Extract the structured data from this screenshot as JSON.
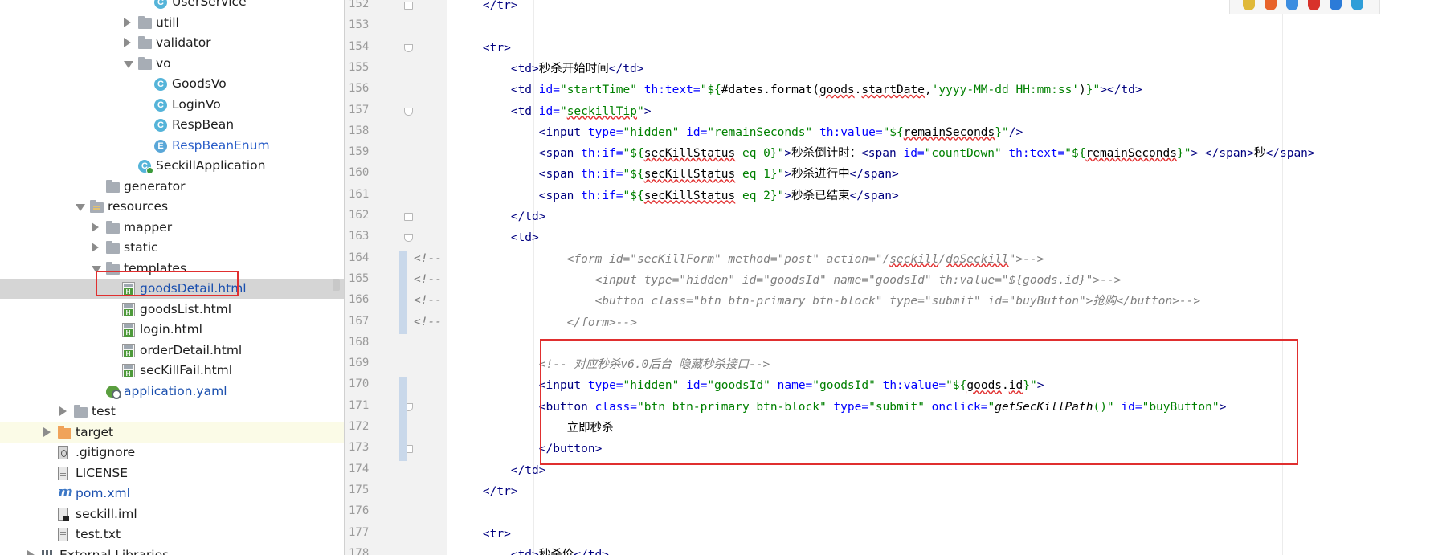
{
  "tree": {
    "items": [
      {
        "label": "UserService",
        "icon": "class-icon",
        "depth": 7
      },
      {
        "label": "utill",
        "icon": "folder-icon",
        "depth": 6,
        "state": "collapsed"
      },
      {
        "label": "validator",
        "icon": "folder-icon",
        "depth": 6,
        "state": "collapsed"
      },
      {
        "label": "vo",
        "icon": "folder-icon",
        "depth": 6,
        "state": "expanded"
      },
      {
        "label": "GoodsVo",
        "icon": "class-icon",
        "depth": 7
      },
      {
        "label": "LoginVo",
        "icon": "class-icon",
        "depth": 7
      },
      {
        "label": "RespBean",
        "icon": "class-icon",
        "depth": 7
      },
      {
        "label": "RespBeanEnum",
        "icon": "enum-icon",
        "depth": 7
      },
      {
        "label": "SeckillApplication",
        "icon": "spring-boot-class-icon",
        "depth": 6
      },
      {
        "label": "generator",
        "icon": "folder-icon",
        "depth": 4
      },
      {
        "label": "resources",
        "icon": "resources-folder-icon",
        "depth": 3,
        "state": "expanded"
      },
      {
        "label": "mapper",
        "icon": "folder-icon",
        "depth": 4,
        "state": "collapsed"
      },
      {
        "label": "static",
        "icon": "folder-icon",
        "depth": 4,
        "state": "collapsed"
      },
      {
        "label": "templates",
        "icon": "folder-icon",
        "depth": 4,
        "state": "expanded"
      },
      {
        "label": "goodsDetail.html",
        "icon": "html-file-icon",
        "depth": 5,
        "selected": true
      },
      {
        "label": "goodsList.html",
        "icon": "html-file-icon",
        "depth": 5
      },
      {
        "label": "login.html",
        "icon": "html-file-icon",
        "depth": 5
      },
      {
        "label": "orderDetail.html",
        "icon": "html-file-icon",
        "depth": 5
      },
      {
        "label": "secKillFail.html",
        "icon": "html-file-icon",
        "depth": 5
      },
      {
        "label": "application.yaml",
        "icon": "yaml-file-icon",
        "depth": 4
      },
      {
        "label": "test",
        "icon": "folder-icon",
        "depth": 2,
        "state": "collapsed"
      },
      {
        "label": "target",
        "icon": "excluded-folder-icon",
        "depth": 1,
        "state": "collapsed"
      },
      {
        "label": ".gitignore",
        "icon": "gitignore-file-icon",
        "depth": 1
      },
      {
        "label": "LICENSE",
        "icon": "text-file-icon",
        "depth": 1
      },
      {
        "label": "pom.xml",
        "icon": "maven-file-icon",
        "depth": 1
      },
      {
        "label": "seckill.iml",
        "icon": "iml-file-icon",
        "depth": 1
      },
      {
        "label": "test.txt",
        "icon": "text-file-icon",
        "depth": 1
      },
      {
        "label": "External Libraries",
        "icon": "libraries-icon",
        "depth": 0,
        "state": "collapsed"
      }
    ]
  },
  "gutter": {
    "line_numbers": [
      "152",
      "153",
      "154",
      "155",
      "156",
      "157",
      "158",
      "159",
      "160",
      "161",
      "162",
      "163",
      "164",
      "165",
      "166",
      "167",
      "168",
      "169",
      "170",
      "171",
      "172",
      "173",
      "174",
      "175",
      "176",
      "177",
      "178"
    ]
  },
  "code": {
    "lines": [
      [
        {
          "t": "    </tr>",
          "c": "tag"
        }
      ],
      [],
      [
        {
          "t": "    <tr>",
          "c": "tag"
        }
      ],
      [
        {
          "t": "        <td>",
          "c": "tag"
        },
        {
          "t": "秒杀开始时间",
          "c": "tx"
        },
        {
          "t": "</td>",
          "c": "tag"
        }
      ],
      [
        {
          "t": "        <td ",
          "c": "tag"
        },
        {
          "t": "id=",
          "c": "attr"
        },
        {
          "t": "\"startTime\" ",
          "c": "str"
        },
        {
          "t": "th:text=",
          "c": "attr"
        },
        {
          "t": "\"${",
          "c": "str"
        },
        {
          "t": "#dates.format(",
          "c": "ev"
        },
        {
          "t": "goods",
          "c": "sq"
        },
        {
          "t": ".",
          "c": "ev"
        },
        {
          "t": "startDate",
          "c": "sq"
        },
        {
          "t": ",",
          "c": "ev"
        },
        {
          "t": "'yyyy-MM-dd HH:mm:ss'",
          "c": "str"
        },
        {
          "t": ")",
          "c": "ev"
        },
        {
          "t": "}\"",
          "c": "str"
        },
        {
          "t": "></td>",
          "c": "tag"
        }
      ],
      [
        {
          "t": "        <td ",
          "c": "tag"
        },
        {
          "t": "id=",
          "c": "attr"
        },
        {
          "t": "\"",
          "c": "str"
        },
        {
          "t": "seckillTip",
          "c": "sqstr"
        },
        {
          "t": "\"",
          "c": "str"
        },
        {
          "t": ">",
          "c": "tag"
        }
      ],
      [
        {
          "t": "            <input ",
          "c": "tag"
        },
        {
          "t": "type=",
          "c": "attr"
        },
        {
          "t": "\"hidden\" ",
          "c": "str"
        },
        {
          "t": "id=",
          "c": "attr"
        },
        {
          "t": "\"remainSeconds\" ",
          "c": "str"
        },
        {
          "t": "th:value=",
          "c": "attr"
        },
        {
          "t": "\"${",
          "c": "str"
        },
        {
          "t": "remainSeconds",
          "c": "sq"
        },
        {
          "t": "}\"",
          "c": "str"
        },
        {
          "t": "/>",
          "c": "tag"
        }
      ],
      [
        {
          "t": "            <span ",
          "c": "tag"
        },
        {
          "t": "th:if=",
          "c": "attr"
        },
        {
          "t": "\"${",
          "c": "str"
        },
        {
          "t": "secKillStatus",
          "c": "sq"
        },
        {
          "t": " eq 0}\"",
          "c": "str"
        },
        {
          "t": ">",
          "c": "tag"
        },
        {
          "t": "秒杀倒计时：",
          "c": "tx"
        },
        {
          "t": "<span ",
          "c": "tag"
        },
        {
          "t": "id=",
          "c": "attr"
        },
        {
          "t": "\"countDown\" ",
          "c": "str"
        },
        {
          "t": "th:text=",
          "c": "attr"
        },
        {
          "t": "\"${",
          "c": "str"
        },
        {
          "t": "remainSeconds",
          "c": "sq"
        },
        {
          "t": "}\"",
          "c": "str"
        },
        {
          "t": "> </span>",
          "c": "tag"
        },
        {
          "t": "秒",
          "c": "tx"
        },
        {
          "t": "</span>",
          "c": "tag"
        }
      ],
      [
        {
          "t": "            <span ",
          "c": "tag"
        },
        {
          "t": "th:if=",
          "c": "attr"
        },
        {
          "t": "\"${",
          "c": "str"
        },
        {
          "t": "secKillStatus",
          "c": "sq"
        },
        {
          "t": " eq 1}\"",
          "c": "str"
        },
        {
          "t": ">",
          "c": "tag"
        },
        {
          "t": "秒杀进行中",
          "c": "tx"
        },
        {
          "t": "</span>",
          "c": "tag"
        }
      ],
      [
        {
          "t": "            <span ",
          "c": "tag"
        },
        {
          "t": "th:if=",
          "c": "attr"
        },
        {
          "t": "\"${",
          "c": "str"
        },
        {
          "t": "secKillStatus",
          "c": "sq"
        },
        {
          "t": " eq 2}\"",
          "c": "str"
        },
        {
          "t": ">",
          "c": "tag"
        },
        {
          "t": "秒杀已结束",
          "c": "tx"
        },
        {
          "t": "</span>",
          "c": "tag"
        }
      ],
      [
        {
          "t": "        </td>",
          "c": "tag"
        }
      ],
      [
        {
          "t": "        <td>",
          "c": "tag"
        }
      ],
      [
        {
          "t": "                <form id=\"secKillForm\" method=\"post\" action=\"/",
          "c": "cm"
        },
        {
          "t": "seckill",
          "c": "cmsq"
        },
        {
          "t": "/",
          "c": "cm"
        },
        {
          "t": "doSeckill",
          "c": "cmsq"
        },
        {
          "t": "\">-->",
          "c": "cm"
        }
      ],
      [
        {
          "t": "                    <input type=\"hidden\" id=\"goodsId\" name=\"goodsId\" th:value=\"${goods.id}\">-->",
          "c": "cm"
        }
      ],
      [
        {
          "t": "                    <button class=\"btn btn-primary btn-block\" type=\"submit\" id=\"buyButton\">抢购</button>-->",
          "c": "cm"
        }
      ],
      [
        {
          "t": "                </form>-->",
          "c": "cm"
        }
      ],
      [],
      [
        {
          "t": "            <!-- 对应秒杀v6.0后台 隐藏秒杀接口-->",
          "c": "cm"
        }
      ],
      [
        {
          "t": "            <input ",
          "c": "tag"
        },
        {
          "t": "type=",
          "c": "attr"
        },
        {
          "t": "\"hidden\" ",
          "c": "str"
        },
        {
          "t": "id=",
          "c": "attr"
        },
        {
          "t": "\"goodsId\" ",
          "c": "str"
        },
        {
          "t": "name=",
          "c": "attr"
        },
        {
          "t": "\"goodsId\" ",
          "c": "str"
        },
        {
          "t": "th:value=",
          "c": "attr"
        },
        {
          "t": "\"${",
          "c": "str"
        },
        {
          "t": "goods",
          "c": "sq"
        },
        {
          "t": ".",
          "c": "ev"
        },
        {
          "t": "id",
          "c": "sq"
        },
        {
          "t": "}\"",
          "c": "str"
        },
        {
          "t": ">",
          "c": "tag"
        }
      ],
      [
        {
          "t": "            <button ",
          "c": "tag"
        },
        {
          "t": "class=",
          "c": "attr"
        },
        {
          "t": "\"btn btn-primary btn-block\" ",
          "c": "str"
        },
        {
          "t": "type=",
          "c": "attr"
        },
        {
          "t": "\"submit\" ",
          "c": "str"
        },
        {
          "t": "onclick=",
          "c": "attr"
        },
        {
          "t": "\"",
          "c": "str"
        },
        {
          "t": "getSecKillPath",
          "c": "it"
        },
        {
          "t": "()\" ",
          "c": "str"
        },
        {
          "t": "id=",
          "c": "attr"
        },
        {
          "t": "\"buyButton\"",
          "c": "str"
        },
        {
          "t": ">",
          "c": "tag"
        }
      ],
      [
        {
          "t": "                立即秒杀",
          "c": "tx"
        }
      ],
      [
        {
          "t": "            </button>",
          "c": "tag"
        }
      ],
      [
        {
          "t": "        </td>",
          "c": "tag"
        }
      ],
      [
        {
          "t": "    </tr>",
          "c": "tag"
        }
      ],
      [],
      [
        {
          "t": "    <tr>",
          "c": "tag"
        }
      ],
      [
        {
          "t": "        <td>",
          "c": "tag"
        },
        {
          "t": "秒杀价",
          "c": "tx"
        },
        {
          "t": "</td>",
          "c": "tag"
        }
      ]
    ],
    "comment_prefix": "<!--"
  },
  "browsers": {
    "icons": [
      "chrome-icon",
      "firefox-icon",
      "safari-icon",
      "opera-icon",
      "ie-icon",
      "edge-icon"
    ]
  }
}
